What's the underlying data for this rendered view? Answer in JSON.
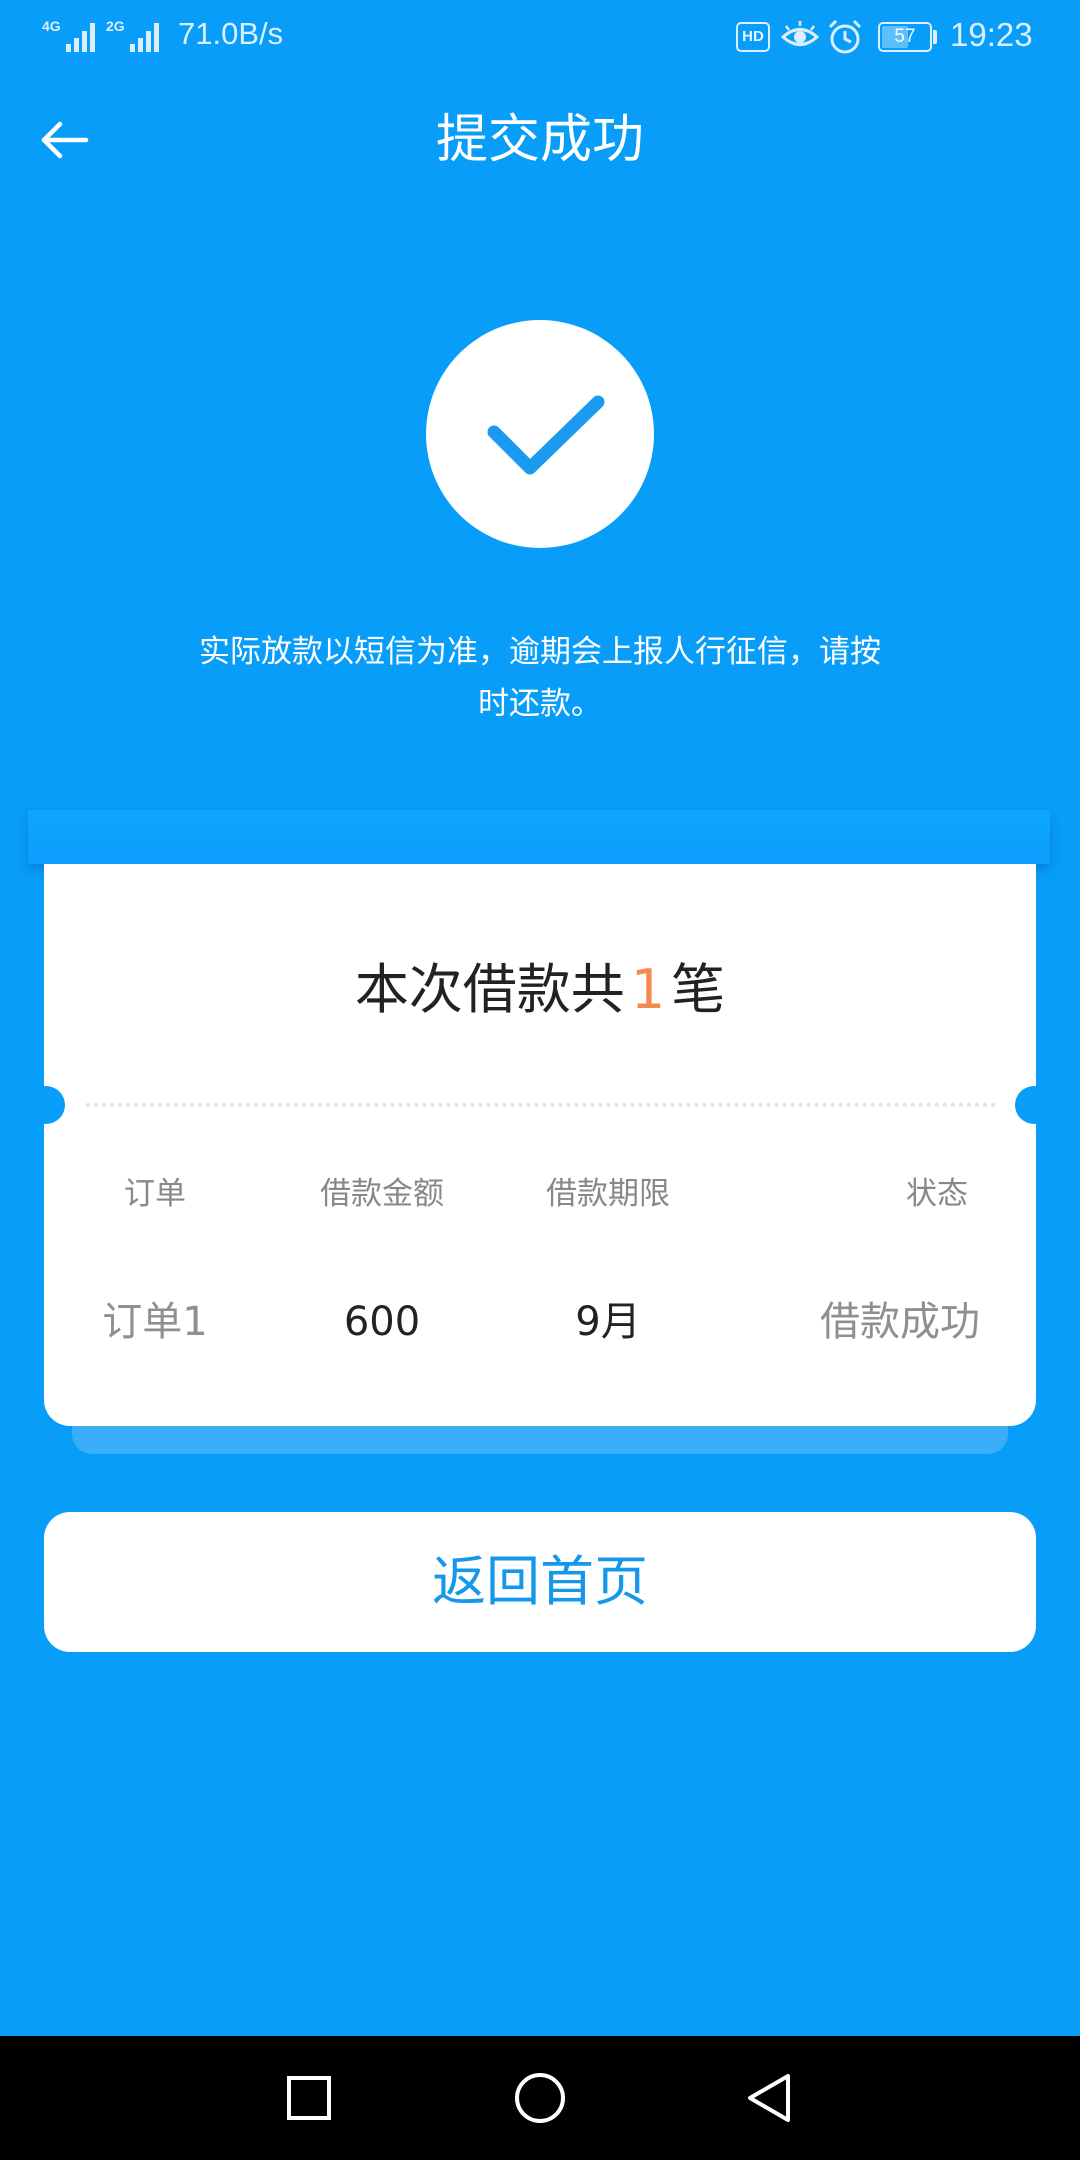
{
  "status_bar": {
    "signal1_label": "4G",
    "signal2_label": "2G",
    "net_speed": "71.0B/s",
    "hd_badge": "HD",
    "battery_level": "57",
    "battery_percent": 57,
    "time": "19:23"
  },
  "header": {
    "title": "提交成功",
    "back_icon": "arrow-left-icon"
  },
  "success": {
    "icon": "checkmark-icon",
    "notice_line1": "实际放款以短信为准，逾期会上报人行征信，请按",
    "notice_line2": "时还款。"
  },
  "summary": {
    "prefix": "本次借款共",
    "count": "1",
    "suffix": "笔",
    "columns": [
      "订单",
      "借款金额",
      "借款期限",
      "状态"
    ],
    "row": {
      "order": "订单1",
      "amount": "600",
      "term": "9月",
      "status": "借款成功"
    }
  },
  "actions": {
    "home_label": "返回首页"
  },
  "nav": {
    "recent_icon": "square-icon",
    "home_icon": "circle-icon",
    "back_icon": "triangle-back-icon"
  },
  "colors": {
    "background": "#089df9",
    "accent_count": "#f58a4e",
    "button_text": "#1597ec"
  }
}
